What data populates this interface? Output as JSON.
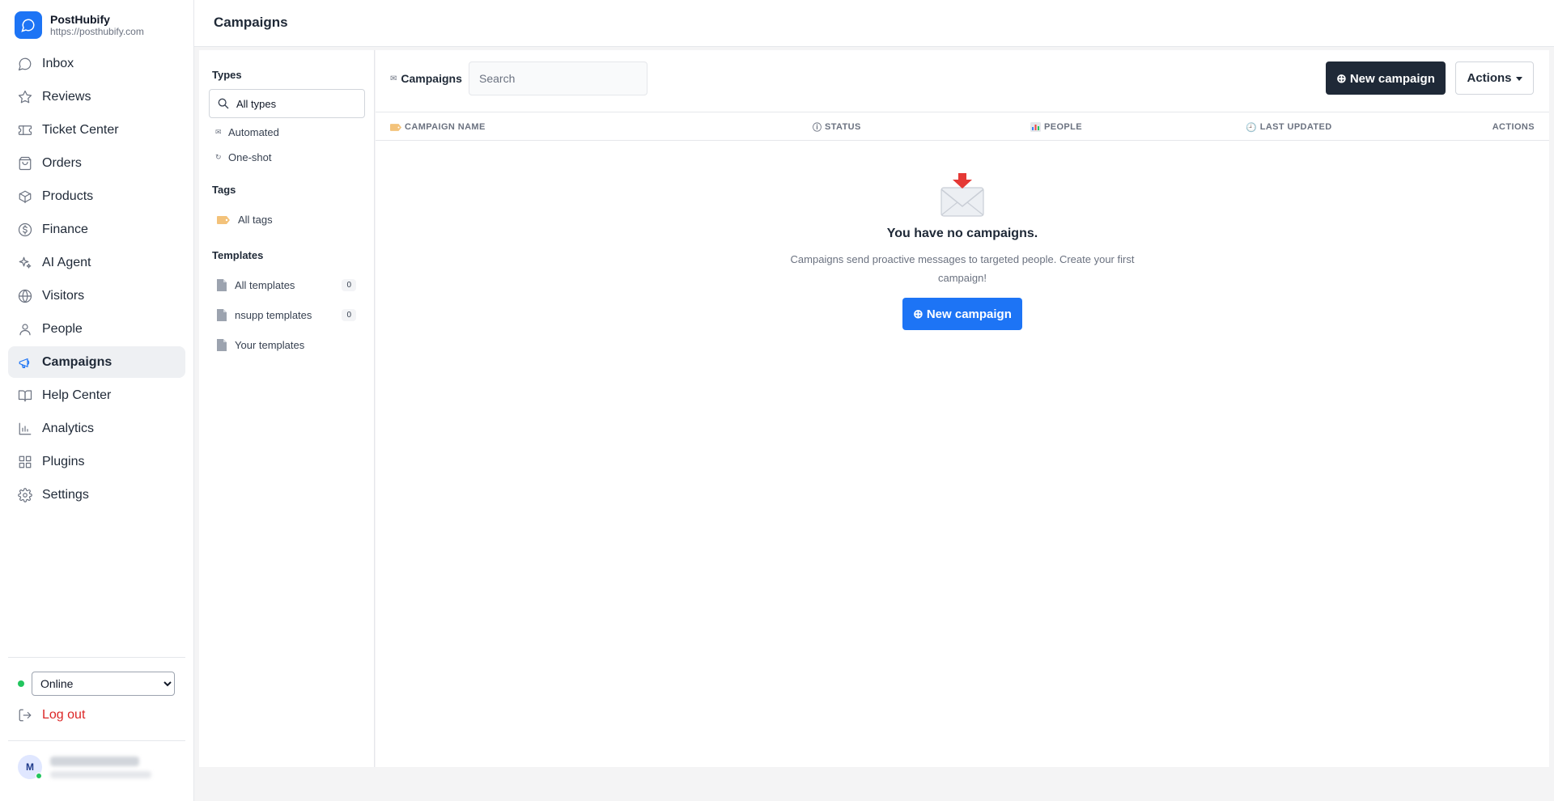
{
  "brand": {
    "name": "PostHubify",
    "url": "https://posthubify.com",
    "accent": "#1d74f5"
  },
  "nav": [
    {
      "label": "Inbox",
      "icon": "message-circle-icon"
    },
    {
      "label": "Reviews",
      "icon": "star-icon"
    },
    {
      "label": "Ticket Center",
      "icon": "ticket-icon"
    },
    {
      "label": "Orders",
      "icon": "shopping-bag-icon"
    },
    {
      "label": "Products",
      "icon": "box-icon"
    },
    {
      "label": "Finance",
      "icon": "dollar-circle-icon"
    },
    {
      "label": "AI Agent",
      "icon": "sparkles-icon"
    },
    {
      "label": "Visitors",
      "icon": "globe-icon"
    },
    {
      "label": "People",
      "icon": "user-icon"
    },
    {
      "label": "Campaigns",
      "icon": "megaphone-icon",
      "active": true
    },
    {
      "label": "Help Center",
      "icon": "book-open-icon"
    },
    {
      "label": "Analytics",
      "icon": "bar-chart-icon"
    },
    {
      "label": "Plugins",
      "icon": "grid-icon"
    },
    {
      "label": "Settings",
      "icon": "gear-icon"
    }
  ],
  "status": {
    "selected": "Online",
    "options": [
      "Online"
    ],
    "color": "#22c55e"
  },
  "logout": {
    "label": "Log out",
    "color": "#dc2626"
  },
  "user": {
    "initial": "M"
  },
  "header": {
    "title": "Campaigns"
  },
  "filters": {
    "types_heading": "Types",
    "all_types": "All types",
    "types": [
      {
        "label": "Automated",
        "icon": "envelope-icon"
      },
      {
        "label": "One-shot",
        "icon": "refresh-icon"
      }
    ],
    "tags_heading": "Tags",
    "all_tags": "All tags",
    "templates_heading": "Templates",
    "templates": [
      {
        "label": "All templates",
        "count": "0"
      },
      {
        "label": "nsupp templates",
        "count": "0"
      },
      {
        "label": "Your templates"
      }
    ]
  },
  "toolbar": {
    "section_label": "Campaigns",
    "search_placeholder": "Search",
    "new_campaign": "⊕ New campaign",
    "actions": "Actions"
  },
  "table": {
    "columns": [
      {
        "label": "Campaign name",
        "icon": "tag-icon"
      },
      {
        "label": "Status",
        "icon": "info-icon"
      },
      {
        "label": "People",
        "icon": "chart-icon"
      },
      {
        "label": "Last updated",
        "icon": "clock-icon"
      },
      {
        "label": "Actions"
      }
    ]
  },
  "empty": {
    "title": "You have no campaigns.",
    "description": "Campaigns send proactive messages to targeted people. Create your first campaign!",
    "button": "⊕ New campaign"
  }
}
